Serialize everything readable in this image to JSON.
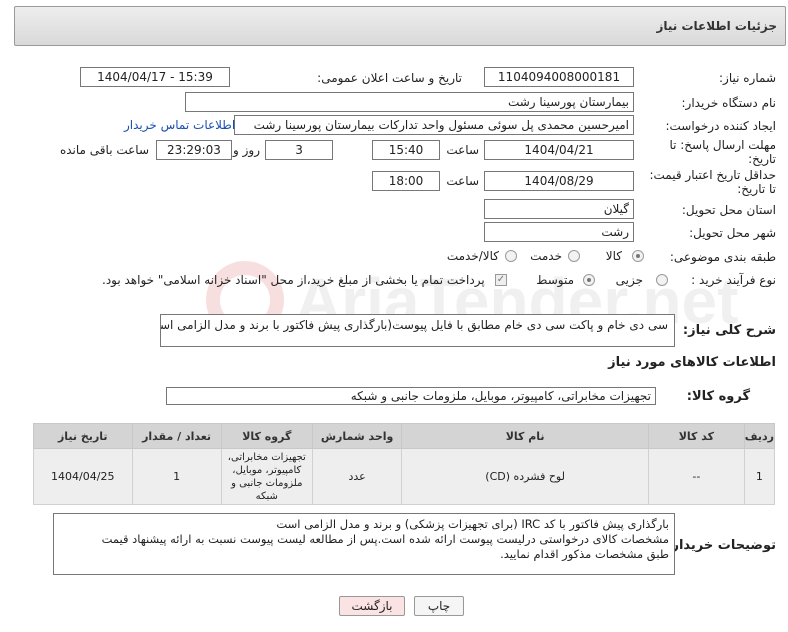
{
  "header": {
    "title": "جزئیات اطلاعات نیاز"
  },
  "watermark": {
    "text": "AriaTender.net"
  },
  "fields": {
    "need_number_label": "شماره نیاز:",
    "need_number": "1104094008000181",
    "announce_label": "تاریخ و ساعت اعلان عمومی:",
    "announce_value": "1404/04/17 - 15:39",
    "buyer_org_label": "نام دستگاه خریدار:",
    "buyer_org": "بیمارستان پورسینا رشت",
    "requester_label": "ایجاد کننده درخواست:",
    "requester": "امیرحسین محمدی پل سوئی مسئول واحد تدارکات بیمارستان پورسینا رشت",
    "contact_link": "اطلاعات تماس خریدار",
    "deadline_label_1": "مهلت ارسال پاسخ: تا",
    "deadline_label_2": "تاریخ:",
    "deadline_date": "1404/04/21",
    "time_word": "ساعت",
    "deadline_time": "15:40",
    "days_count": "3",
    "days_and": "روز و",
    "remaining_time": "23:29:03",
    "remaining_label": "ساعت باقی مانده",
    "validity_label_1": "حداقل تاریخ اعتبار قیمت:",
    "validity_label_2": "تا تاریخ:",
    "validity_date": "1404/08/29",
    "validity_time": "18:00",
    "province_label": "استان محل تحویل:",
    "province": "گیلان",
    "city_label": "شهر محل تحویل:",
    "city": "رشت",
    "category_label": "طبقه بندی موضوعی:",
    "category_options": [
      "کالا",
      "خدمت",
      "کالا/خدمت"
    ],
    "process_label": "نوع فرآیند خرید :",
    "process_options": [
      "جزیی",
      "متوسط"
    ],
    "payment_note": "پرداخت تمام یا بخشی از مبلغ خرید،از محل \"اسناد خزانه اسلامی\" خواهد بود."
  },
  "summary": {
    "label": "شرح کلی نیاز:",
    "text": "سی دی خام و پاکت سی دی خام مطابق با فایل پیوست(بارگذاری پیش فاکتور با برند و مدل الزامی است)"
  },
  "goods_section": {
    "title": "اطلاعات کالاهای مورد نیاز",
    "group_label": "گروه کالا:",
    "group_value": "تجهیزات مخابراتی، کامپیوتر، موبایل، ملزومات جانبی و شبکه"
  },
  "table": {
    "headers": [
      "ردیف",
      "کد کالا",
      "نام کالا",
      "واحد شمارش",
      "گروه کالا",
      "تعداد / مقدار",
      "تاریخ نیاز"
    ],
    "rows": [
      [
        "1",
        "--",
        "لوح فشرده (CD)",
        "عدد",
        "تجهیزات مخابراتی، کامپیوتر، موبایل، ملزومات جانبی و شبکه",
        "1",
        "1404/04/25"
      ]
    ]
  },
  "buyer_notes": {
    "label": "توضیحات خریدار:",
    "lines": [
      "بارگذاری پیش فاکتور با کد IRC (برای تجهیزات پزشکی) و برند و مدل الزامی است",
      "مشخصات کالای درخواستی درلیست پیوست ارائه شده است.پس از مطالعه لیست پیوست نسبت به ارائه پیشنهاد قیمت",
      "طبق مشخصات مذکور اقدام نمایید."
    ]
  },
  "buttons": {
    "print": "چاپ",
    "back": "بازگشت"
  },
  "colors": {
    "link": "#1a4fb0",
    "back_button": "#fbe3e3",
    "header_bg": "#e3e3e3"
  }
}
